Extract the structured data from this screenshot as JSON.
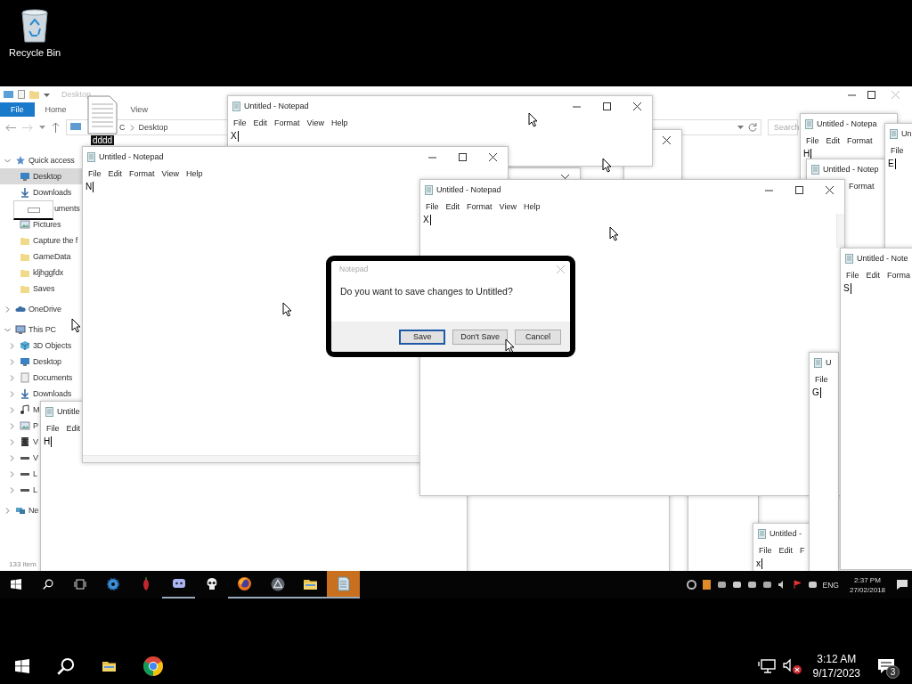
{
  "desktop": {
    "icons": [
      {
        "label": "Recycle Bin"
      }
    ]
  },
  "recording": {
    "explorer": {
      "title": "Desktop",
      "ribbon_tabs": [
        {
          "label": "File",
          "selected": true
        },
        {
          "label": "Home",
          "selected": false
        },
        {
          "label": "View",
          "selected": false
        }
      ],
      "address": [
        "C",
        "Desktop"
      ],
      "search": {
        "placeholder": "Search"
      },
      "nav": [
        {
          "label": "Quick access",
          "kind": "star",
          "expanded": true,
          "selected": false,
          "children": [
            {
              "label": "Desktop",
              "kind": "desktop",
              "selected": true
            },
            {
              "label": "Downloads",
              "kind": "download",
              "selected": false
            },
            {
              "label": "uments",
              "selected": false,
              "kind": "document"
            },
            {
              "label": "Pictures",
              "kind": "pictures",
              "selected": false
            },
            {
              "label": "Capture the f",
              "kind": "folder",
              "selected": false
            },
            {
              "label": "GameData",
              "kind": "folder",
              "selected": false
            },
            {
              "label": "kljhggfdx",
              "kind": "folder",
              "selected": false
            },
            {
              "label": "Saves",
              "kind": "folder",
              "selected": false
            }
          ]
        },
        {
          "label": "OneDrive",
          "kind": "cloud",
          "expanded": false,
          "selected": false
        },
        {
          "label": "This PC",
          "kind": "computer",
          "expanded": true,
          "selected": false,
          "children": [
            {
              "label": "3D Objects",
              "kind": "cube",
              "expanded": false,
              "selected": false
            },
            {
              "label": "Desktop",
              "kind": "desktop",
              "expanded": false,
              "selected": false
            },
            {
              "label": "Documents",
              "kind": "document",
              "expanded": false,
              "selected": false
            },
            {
              "label": "Downloads",
              "kind": "download",
              "expanded": false,
              "selected": false
            },
            {
              "label": "M",
              "kind": "music",
              "expanded": false,
              "selected": false
            },
            {
              "label": "P",
              "kind": "pictures",
              "expanded": false,
              "selected": false
            },
            {
              "label": "V",
              "kind": "video",
              "expanded": false,
              "selected": false
            },
            {
              "label": "V",
              "kind": "drive",
              "expanded": false,
              "selected": false
            },
            {
              "label": "L",
              "kind": "drive",
              "expanded": false,
              "selected": false
            },
            {
              "label": "L",
              "kind": "drive",
              "expanded": false,
              "selected": false
            }
          ]
        },
        {
          "label": "Ne",
          "kind": "network",
          "expanded": false,
          "selected": false
        }
      ],
      "status": "133 item"
    },
    "desktop_file": {
      "label": "dddd"
    },
    "notepads": [
      {
        "title": "Untitled -",
        "menus": [
          "File",
          "Edit",
          "F"
        ],
        "text": "x"
      },
      {
        "title": "Untitle",
        "menus": [
          "File",
          "Edit"
        ],
        "text": "H"
      },
      {
        "title": "Untitled - Notepad",
        "menus": [
          "File",
          "Edit",
          "Format",
          "View",
          "Help"
        ],
        "text": "X"
      },
      {
        "title": "Untitled - Notepad",
        "menus": [
          "File",
          "Edit",
          "Format",
          "View",
          "Help"
        ],
        "text": "N"
      },
      {
        "title": "Untitled - Notepa",
        "menus": [
          "File",
          "Edit",
          "Format"
        ],
        "text": "H"
      },
      {
        "title": "Untitled - Notep",
        "menus": [
          "Format"
        ]
      },
      {
        "title": "Un",
        "menus": [
          "File"
        ],
        "text": "E"
      },
      {
        "title": "Untitled - Notepad",
        "menus": [
          "File",
          "Edit",
          "Format",
          "View",
          "Help"
        ],
        "text": "X"
      },
      {
        "title": "U",
        "menus": [
          "File"
        ],
        "text": "G"
      },
      {
        "title": "Untitled - Note",
        "menus": [
          "File",
          "Edit",
          "Forma"
        ],
        "text": "S"
      }
    ],
    "dialog": {
      "title": "Notepad",
      "message": "Do you want to save changes to Untitled?",
      "buttons": [
        {
          "label": "Save",
          "selected": true
        },
        {
          "label": "Don't Save",
          "selected": false
        },
        {
          "label": "Cancel",
          "selected": false
        }
      ]
    },
    "taskbar": {
      "apps": [
        {
          "kind": "gear",
          "running": false,
          "selected": false
        },
        {
          "kind": "pepper",
          "running": false,
          "selected": false
        },
        {
          "kind": "chat",
          "running": true,
          "selected": false
        },
        {
          "kind": "skull",
          "running": false,
          "selected": false
        },
        {
          "kind": "globe",
          "running": true,
          "selected": false
        },
        {
          "kind": "triangle",
          "running": true,
          "selected": false
        },
        {
          "kind": "folder",
          "running": true,
          "selected": false
        },
        {
          "kind": "notepad",
          "running": true,
          "selected": true
        }
      ],
      "language": "ENG",
      "time": "2:37 PM",
      "date": "27/02/2018"
    }
  },
  "taskbar": {
    "apps": [
      {
        "kind": "folder"
      },
      {
        "kind": "browser"
      }
    ],
    "volume": {
      "muted": true
    },
    "time": "3:12 AM",
    "date": "9/17/2023",
    "notifications": "3"
  }
}
